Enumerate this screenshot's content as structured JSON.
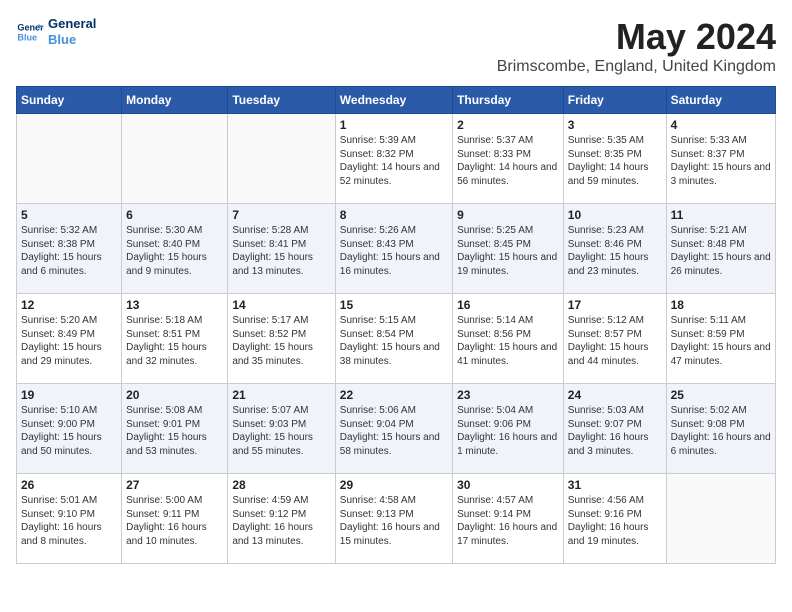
{
  "logo": {
    "text_general": "General",
    "text_blue": "Blue"
  },
  "title": "May 2024",
  "subtitle": "Brimscombe, England, United Kingdom",
  "days_of_week": [
    "Sunday",
    "Monday",
    "Tuesday",
    "Wednesday",
    "Thursday",
    "Friday",
    "Saturday"
  ],
  "weeks": [
    [
      {
        "day": "",
        "info": ""
      },
      {
        "day": "",
        "info": ""
      },
      {
        "day": "",
        "info": ""
      },
      {
        "day": "1",
        "info": "Sunrise: 5:39 AM\nSunset: 8:32 PM\nDaylight: 14 hours and 52 minutes."
      },
      {
        "day": "2",
        "info": "Sunrise: 5:37 AM\nSunset: 8:33 PM\nDaylight: 14 hours and 56 minutes."
      },
      {
        "day": "3",
        "info": "Sunrise: 5:35 AM\nSunset: 8:35 PM\nDaylight: 14 hours and 59 minutes."
      },
      {
        "day": "4",
        "info": "Sunrise: 5:33 AM\nSunset: 8:37 PM\nDaylight: 15 hours and 3 minutes."
      }
    ],
    [
      {
        "day": "5",
        "info": "Sunrise: 5:32 AM\nSunset: 8:38 PM\nDaylight: 15 hours and 6 minutes."
      },
      {
        "day": "6",
        "info": "Sunrise: 5:30 AM\nSunset: 8:40 PM\nDaylight: 15 hours and 9 minutes."
      },
      {
        "day": "7",
        "info": "Sunrise: 5:28 AM\nSunset: 8:41 PM\nDaylight: 15 hours and 13 minutes."
      },
      {
        "day": "8",
        "info": "Sunrise: 5:26 AM\nSunset: 8:43 PM\nDaylight: 15 hours and 16 minutes."
      },
      {
        "day": "9",
        "info": "Sunrise: 5:25 AM\nSunset: 8:45 PM\nDaylight: 15 hours and 19 minutes."
      },
      {
        "day": "10",
        "info": "Sunrise: 5:23 AM\nSunset: 8:46 PM\nDaylight: 15 hours and 23 minutes."
      },
      {
        "day": "11",
        "info": "Sunrise: 5:21 AM\nSunset: 8:48 PM\nDaylight: 15 hours and 26 minutes."
      }
    ],
    [
      {
        "day": "12",
        "info": "Sunrise: 5:20 AM\nSunset: 8:49 PM\nDaylight: 15 hours and 29 minutes."
      },
      {
        "day": "13",
        "info": "Sunrise: 5:18 AM\nSunset: 8:51 PM\nDaylight: 15 hours and 32 minutes."
      },
      {
        "day": "14",
        "info": "Sunrise: 5:17 AM\nSunset: 8:52 PM\nDaylight: 15 hours and 35 minutes."
      },
      {
        "day": "15",
        "info": "Sunrise: 5:15 AM\nSunset: 8:54 PM\nDaylight: 15 hours and 38 minutes."
      },
      {
        "day": "16",
        "info": "Sunrise: 5:14 AM\nSunset: 8:56 PM\nDaylight: 15 hours and 41 minutes."
      },
      {
        "day": "17",
        "info": "Sunrise: 5:12 AM\nSunset: 8:57 PM\nDaylight: 15 hours and 44 minutes."
      },
      {
        "day": "18",
        "info": "Sunrise: 5:11 AM\nSunset: 8:59 PM\nDaylight: 15 hours and 47 minutes."
      }
    ],
    [
      {
        "day": "19",
        "info": "Sunrise: 5:10 AM\nSunset: 9:00 PM\nDaylight: 15 hours and 50 minutes."
      },
      {
        "day": "20",
        "info": "Sunrise: 5:08 AM\nSunset: 9:01 PM\nDaylight: 15 hours and 53 minutes."
      },
      {
        "day": "21",
        "info": "Sunrise: 5:07 AM\nSunset: 9:03 PM\nDaylight: 15 hours and 55 minutes."
      },
      {
        "day": "22",
        "info": "Sunrise: 5:06 AM\nSunset: 9:04 PM\nDaylight: 15 hours and 58 minutes."
      },
      {
        "day": "23",
        "info": "Sunrise: 5:04 AM\nSunset: 9:06 PM\nDaylight: 16 hours and 1 minute."
      },
      {
        "day": "24",
        "info": "Sunrise: 5:03 AM\nSunset: 9:07 PM\nDaylight: 16 hours and 3 minutes."
      },
      {
        "day": "25",
        "info": "Sunrise: 5:02 AM\nSunset: 9:08 PM\nDaylight: 16 hours and 6 minutes."
      }
    ],
    [
      {
        "day": "26",
        "info": "Sunrise: 5:01 AM\nSunset: 9:10 PM\nDaylight: 16 hours and 8 minutes."
      },
      {
        "day": "27",
        "info": "Sunrise: 5:00 AM\nSunset: 9:11 PM\nDaylight: 16 hours and 10 minutes."
      },
      {
        "day": "28",
        "info": "Sunrise: 4:59 AM\nSunset: 9:12 PM\nDaylight: 16 hours and 13 minutes."
      },
      {
        "day": "29",
        "info": "Sunrise: 4:58 AM\nSunset: 9:13 PM\nDaylight: 16 hours and 15 minutes."
      },
      {
        "day": "30",
        "info": "Sunrise: 4:57 AM\nSunset: 9:14 PM\nDaylight: 16 hours and 17 minutes."
      },
      {
        "day": "31",
        "info": "Sunrise: 4:56 AM\nSunset: 9:16 PM\nDaylight: 16 hours and 19 minutes."
      },
      {
        "day": "",
        "info": ""
      }
    ]
  ]
}
